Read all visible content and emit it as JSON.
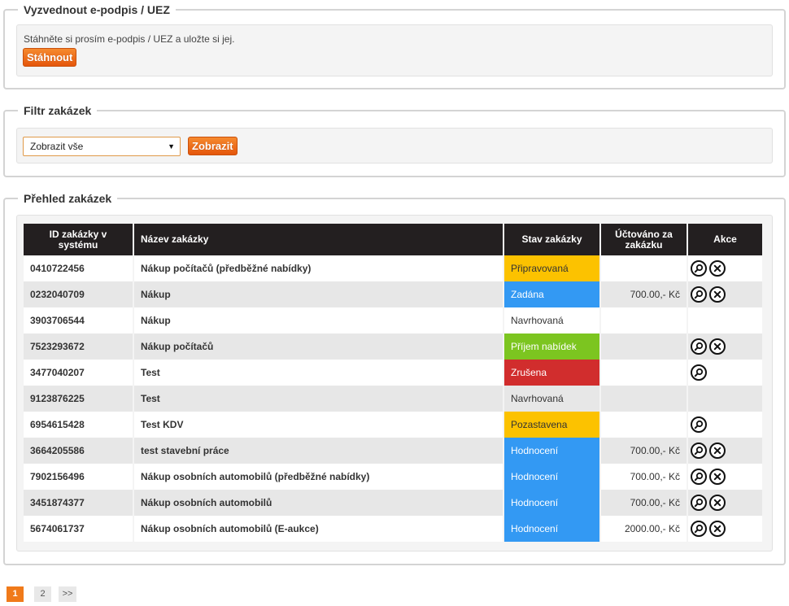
{
  "signature_panel": {
    "legend": "Vyzvednout e-podpis / UEZ",
    "message": "Stáhněte si prosím e-podpis / UEZ a uložte si jej.",
    "download_label": "Stáhnout"
  },
  "filter_panel": {
    "legend": "Filtr zakázek",
    "select_value": "Zobrazit vše",
    "show_label": "Zobrazit"
  },
  "orders_panel": {
    "legend": "Přehled zakázek",
    "headers": {
      "id": "ID zakázky v systému",
      "name": "Název zakázky",
      "status": "Stav zakázky",
      "billed": "Účtováno za zakázku",
      "actions": "Akce"
    },
    "rows": [
      {
        "id": "0410722456",
        "name": "Nákup počítačů (předběžné nabídky)",
        "status": "Připravovaná",
        "status_color": "#fcc200",
        "billed": "",
        "actions": [
          "detail",
          "cancel"
        ]
      },
      {
        "id": "0232040709",
        "name": "Nákup",
        "status": "Zadána",
        "status_color": "#3399f3",
        "billed": "700.00,- Kč",
        "actions": [
          "detail",
          "cancel"
        ]
      },
      {
        "id": "3903706544",
        "name": "Nákup",
        "status": "Navrhovaná",
        "status_color": "",
        "billed": "",
        "actions": []
      },
      {
        "id": "7523293672",
        "name": "Nákup počítačů",
        "status": "Příjem nabídek",
        "status_color": "#7cc520",
        "billed": "",
        "actions": [
          "detail",
          "cancel"
        ]
      },
      {
        "id": "3477040207",
        "name": "Test",
        "status": "Zrušena",
        "status_color": "#d12d2d",
        "billed": "",
        "actions": [
          "detail"
        ]
      },
      {
        "id": "9123876225",
        "name": "Test",
        "status": "Navrhovaná",
        "status_color": "",
        "billed": "",
        "actions": []
      },
      {
        "id": "6954615428",
        "name": "Test KDV",
        "status": "Pozastavena",
        "status_color": "#fcc200",
        "billed": "",
        "actions": [
          "detail"
        ]
      },
      {
        "id": "3664205586",
        "name": "test stavební práce",
        "status": "Hodnocení",
        "status_color": "#3399f3",
        "billed": "700.00,- Kč",
        "actions": [
          "detail",
          "cancel"
        ]
      },
      {
        "id": "7902156496",
        "name": "Nákup osobních automobilů (předběžné nabídky)",
        "status": "Hodnocení",
        "status_color": "#3399f3",
        "billed": "700.00,- Kč",
        "actions": [
          "detail",
          "cancel"
        ]
      },
      {
        "id": "3451874377",
        "name": "Nákup osobních automobilů",
        "status": "Hodnocení",
        "status_color": "#3399f3",
        "billed": "700.00,- Kč",
        "actions": [
          "detail",
          "cancel"
        ]
      },
      {
        "id": "5674061737",
        "name": "Nákup osobních automobilů (E-aukce)",
        "status": "Hodnocení",
        "status_color": "#3399f3",
        "billed": "2000.00,- Kč",
        "actions": [
          "detail",
          "cancel"
        ]
      }
    ]
  },
  "pagination": {
    "pages": [
      "1",
      "2"
    ],
    "current": "1",
    "next_label": ">>"
  },
  "colors": {
    "accent_orange": "#f07a1a",
    "header_dark": "#231f20",
    "row_alt": "#e7e7e7"
  }
}
